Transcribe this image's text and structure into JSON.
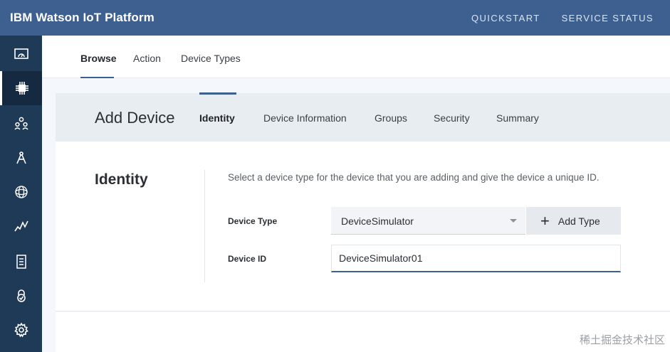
{
  "app": {
    "title": "IBM Watson IoT Platform",
    "nav": [
      "QUICKSTART",
      "SERVICE STATUS"
    ]
  },
  "sidebar": {
    "icons": [
      {
        "name": "dashboard-icon",
        "active": false
      },
      {
        "name": "devices-icon",
        "active": true
      },
      {
        "name": "members-icon",
        "active": false
      },
      {
        "name": "apps-icon",
        "active": false
      },
      {
        "name": "extensions-icon",
        "active": false
      },
      {
        "name": "usage-icon",
        "active": false
      },
      {
        "name": "rules-icon",
        "active": false
      },
      {
        "name": "security-icon",
        "active": false
      },
      {
        "name": "settings-icon",
        "active": false
      }
    ]
  },
  "tabs": {
    "items": [
      "Browse",
      "Action",
      "Device Types"
    ],
    "active": "Browse"
  },
  "wizard": {
    "title": "Add Device",
    "steps": [
      "Identity",
      "Device Information",
      "Groups",
      "Security",
      "Summary"
    ],
    "active_step": "Identity",
    "section_title": "Identity",
    "description": "Select a device type for the device that you are adding and give the device a unique ID.",
    "device_type_label": "Device Type",
    "device_type_value": "DeviceSimulator",
    "add_type_label": "Add Type",
    "device_id_label": "Device ID",
    "device_id_value": "DeviceSimulator01"
  },
  "watermark": "稀土掘金技术社区",
  "colors": {
    "topbar": "#3e6090",
    "sidebar": "#1f3a56",
    "accent": "#3e6090"
  }
}
